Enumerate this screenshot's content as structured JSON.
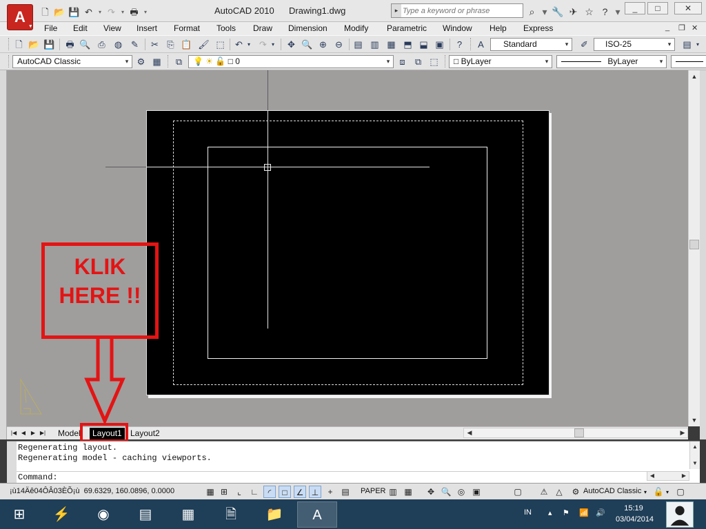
{
  "titlebar": {
    "app_name": "AutoCAD 2010",
    "document": "Drawing1.dwg",
    "app_button_glyph": "A",
    "search_placeholder": "Type a keyword or phrase"
  },
  "menubar": {
    "items": [
      "File",
      "Edit",
      "View",
      "Insert",
      "Format",
      "Tools",
      "Draw",
      "Dimension",
      "Modify",
      "Parametric",
      "Window",
      "Help",
      "Express"
    ]
  },
  "toolbar1": {
    "text_style": "Standard",
    "dim_style": "ISO-25"
  },
  "toolbar2": {
    "workspace": "AutoCAD Classic",
    "layer": "0",
    "color": "ByLayer",
    "linetype": "ByLayer"
  },
  "annotation": {
    "line1": "KLIK",
    "line2": "HERE !!",
    "color": "#e31414"
  },
  "tabs": {
    "model": "Model",
    "layout1": "Layout1",
    "layout2": "Layout2",
    "active": "Layout1"
  },
  "command": {
    "history": [
      "Regenerating layout.",
      "Regenerating model - caching viewports."
    ],
    "prompt": "Command:"
  },
  "statusbar": {
    "coordinates": "69.6329, 160.0896, 0.0000",
    "garbled_prefix": "¡ù14Äê04ÔÂ03ÈÕ¡ù",
    "paper_label": "PAPER",
    "workspace_label": "AutoCAD Classic"
  },
  "taskbar": {
    "language": "IN",
    "time": "15:19",
    "date": "03/04/2014"
  },
  "colors": {
    "paper": "#000000",
    "drawing_background": "#a09d9d",
    "taskbar": "#1f3e57",
    "accent_red": "#c8261f"
  }
}
